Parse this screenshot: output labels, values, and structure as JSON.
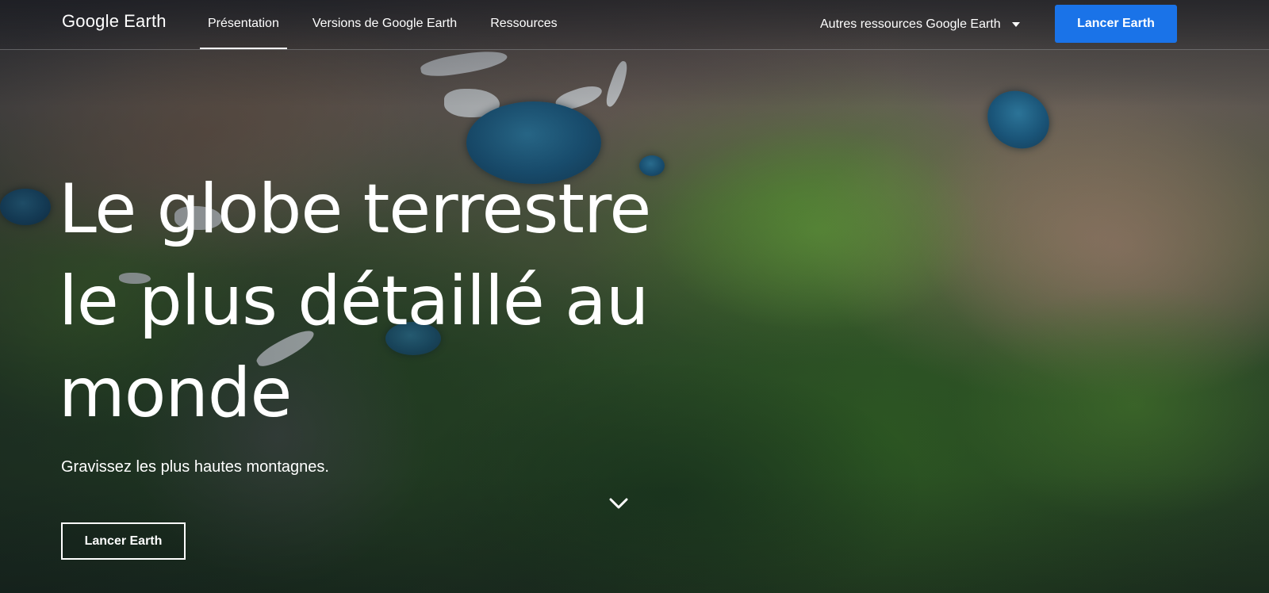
{
  "header": {
    "logo_google": "Google",
    "logo_earth": "Earth",
    "nav": [
      {
        "label": "Présentation",
        "active": true
      },
      {
        "label": "Versions de Google Earth",
        "active": false
      },
      {
        "label": "Ressources",
        "active": false
      }
    ],
    "more_resources_label": "Autres ressources Google Earth",
    "launch_label": "Lancer Earth"
  },
  "hero": {
    "title_lines": [
      "Le globe terrestre",
      "le plus détaillé au",
      "monde"
    ],
    "subtitle": "Gravissez les plus hautes montagnes.",
    "launch_label": "Lancer Earth"
  },
  "colors": {
    "primary_button": "#1a73e8",
    "text": "#ffffff"
  },
  "icons": {
    "dropdown": "caret-down-icon",
    "scroll": "chevron-down-icon"
  }
}
